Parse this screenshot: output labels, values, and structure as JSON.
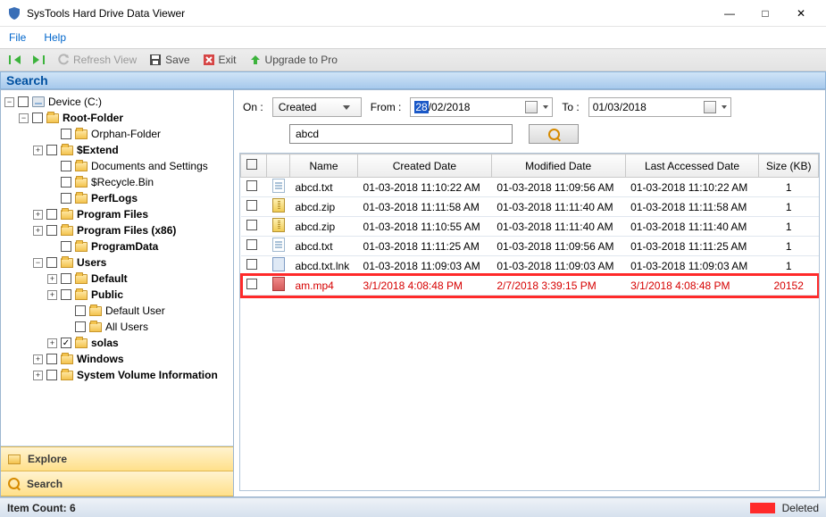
{
  "app": {
    "title": "SysTools Hard Drive Data Viewer"
  },
  "menu": {
    "file": "File",
    "help": "Help"
  },
  "toolbar": {
    "refresh": "Refresh View",
    "save": "Save",
    "exit": "Exit",
    "upgrade": "Upgrade to Pro"
  },
  "searchHeader": "Search",
  "tree": {
    "device": "Device (C:)",
    "root": "Root-Folder",
    "orphan": "Orphan-Folder",
    "extend": "$Extend",
    "docs": "Documents and Settings",
    "recycle": "$Recycle.Bin",
    "perflogs": "PerfLogs",
    "progfiles": "Program Files",
    "progfiles86": "Program Files (x86)",
    "progdata": "ProgramData",
    "users": "Users",
    "default": "Default",
    "public": "Public",
    "defaultuser": "Default User",
    "allusers": "All Users",
    "solas": "solas",
    "windows": "Windows",
    "sysvol": "System Volume Information"
  },
  "leftTabs": {
    "explore": "Explore",
    "search": "Search"
  },
  "filters": {
    "onLabel": "On :",
    "onValue": "Created",
    "fromLabel": "From :",
    "fromDay": "28",
    "fromRest": "/02/2018",
    "toLabel": "To :",
    "toValue": "01/03/2018",
    "text": "abcd"
  },
  "columns": {
    "name": "Name",
    "created": "Created Date",
    "modified": "Modified Date",
    "accessed": "Last Accessed Date",
    "size": "Size (KB)"
  },
  "rows": [
    {
      "icon": "doc",
      "name": "abcd.txt",
      "created": "01-03-2018 11:10:22 AM",
      "modified": "01-03-2018 11:09:56 AM",
      "accessed": "01-03-2018 11:10:22 AM",
      "size": "1",
      "deleted": false
    },
    {
      "icon": "zip",
      "name": "abcd.zip",
      "created": "01-03-2018 11:11:58 AM",
      "modified": "01-03-2018 11:11:40 AM",
      "accessed": "01-03-2018 11:11:58 AM",
      "size": "1",
      "deleted": false
    },
    {
      "icon": "zip",
      "name": "abcd.zip",
      "created": "01-03-2018 11:10:55 AM",
      "modified": "01-03-2018 11:11:40 AM",
      "accessed": "01-03-2018 11:11:40 AM",
      "size": "1",
      "deleted": false
    },
    {
      "icon": "doc",
      "name": "abcd.txt",
      "created": "01-03-2018 11:11:25 AM",
      "modified": "01-03-2018 11:09:56 AM",
      "accessed": "01-03-2018 11:11:25 AM",
      "size": "1",
      "deleted": false
    },
    {
      "icon": "lnk",
      "name": "abcd.txt.lnk",
      "created": "01-03-2018 11:09:03 AM",
      "modified": "01-03-2018 11:09:03 AM",
      "accessed": "01-03-2018 11:09:03 AM",
      "size": "1",
      "deleted": false
    },
    {
      "icon": "vid",
      "name": "am.mp4",
      "created": "3/1/2018 4:08:48 PM",
      "modified": "2/7/2018 3:39:15 PM",
      "accessed": "3/1/2018 4:08:48 PM",
      "size": "20152",
      "deleted": true
    }
  ],
  "status": {
    "count": "Item Count: 6",
    "deleted": "Deleted"
  }
}
